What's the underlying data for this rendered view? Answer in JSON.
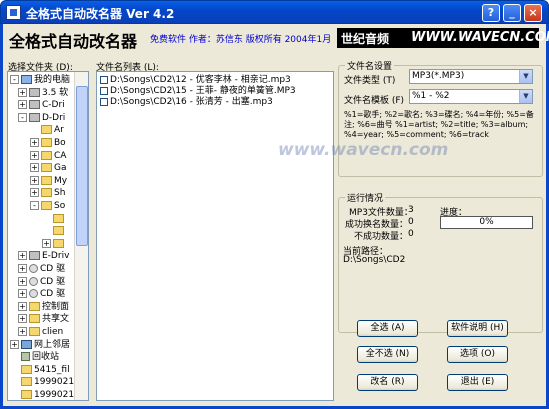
{
  "window": {
    "title": "全格式自动改名器 Ver 4.2",
    "controls": {
      "help": "?",
      "minimize": "_",
      "close": "×"
    }
  },
  "banner": {
    "app_name": "全格式自动改名器",
    "credits": "免费软件  作者：苏信东  版权所有  2004年1月",
    "logo_cn": "世纪音频",
    "logo_url": "WWW.WAVECN.COM"
  },
  "folder_panel": {
    "label": "选择文件夹 (D):",
    "tree": [
      {
        "text": "我的电脑",
        "icon": "pc-icon",
        "exp": "-"
      },
      {
        "text": "3.5 软",
        "icon": "drive-icon",
        "exp": "+"
      },
      {
        "text": "C-Dri",
        "icon": "drive-icon",
        "exp": "+"
      },
      {
        "text": "D-Dri",
        "icon": "drive-icon",
        "exp": "-"
      },
      {
        "text": "Ar",
        "icon": "folder-icon",
        "exp": ""
      },
      {
        "text": "Bo",
        "icon": "folder-icon",
        "exp": "+"
      },
      {
        "text": "CA",
        "icon": "folder-icon",
        "exp": "+"
      },
      {
        "text": "Ga",
        "icon": "folder-icon",
        "exp": "+"
      },
      {
        "text": "My",
        "icon": "folder-icon",
        "exp": "+"
      },
      {
        "text": "Sh",
        "icon": "folder-icon",
        "exp": "+"
      },
      {
        "text": "So",
        "icon": "folder-icon",
        "exp": "-"
      },
      {
        "text": "",
        "icon": "folder-icon",
        "exp": ""
      },
      {
        "text": "",
        "icon": "folder-icon",
        "exp": ""
      },
      {
        "text": "",
        "icon": "folder-icon",
        "exp": "+"
      },
      {
        "text": "E-Driv",
        "icon": "drive-icon",
        "exp": "+"
      },
      {
        "text": "CD 驱",
        "icon": "cd-icon",
        "exp": "+"
      },
      {
        "text": "CD 驱",
        "icon": "cd-icon",
        "exp": "+"
      },
      {
        "text": "CD 驱",
        "icon": "cd-icon",
        "exp": "+"
      },
      {
        "text": "控制面",
        "icon": "folder-icon",
        "exp": "+"
      },
      {
        "text": "共享文",
        "icon": "folder-icon",
        "exp": "+"
      },
      {
        "text": "clien",
        "icon": "folder-icon",
        "exp": "+"
      },
      {
        "text": "网上邻居",
        "icon": "network-icon",
        "exp": "+"
      },
      {
        "text": "回收站",
        "icon": "trash-icon",
        "exp": ""
      },
      {
        "text": "5415_fil",
        "icon": "folder-icon",
        "exp": ""
      },
      {
        "text": "19990219",
        "icon": "folder-icon",
        "exp": ""
      },
      {
        "text": "19990219",
        "icon": "folder-icon",
        "exp": ""
      }
    ]
  },
  "file_panel": {
    "label": "文件名列表 (L):",
    "files": [
      "D:\\Songs\\CD2\\12 - 优客李林 - 相亲记.mp3",
      "D:\\Songs\\CD2\\15 - 王菲- 静夜的单簧管.MP3",
      "D:\\Songs\\CD2\\16 - 张清芳 - 出塞.mp3"
    ]
  },
  "settings": {
    "group_title": "文件名设置",
    "type_label": "文件类型 (T)",
    "type_value": "MP3(*.MP3)",
    "template_label": "文件名模板 (F)",
    "template_value": "%1 - %2",
    "help_text": "%1=歌手; %2=歌名; %3=碟名; %4=年份; %5=备注; %6=曲号 %1=artist; %2=title; %3=album; %4=year; %5=comment; %6=track"
  },
  "status": {
    "group_title": "运行情况",
    "mp3_count_label": "MP3文件数量：",
    "mp3_count": "3",
    "success_label": "成功换名数量：",
    "success_count": "0",
    "fail_label": "不成功数量：",
    "fail_count": "0",
    "progress_label": "进度：",
    "progress_text": "0%",
    "progress_value": 0,
    "path_label": "当前路径：",
    "path_value": "D:\\Songs\\CD2"
  },
  "buttons": {
    "select_all": "全选 (A)",
    "help": "软件说明 (H)",
    "deselect_all": "全不选 (N)",
    "options": "选项 (O)",
    "rename": "改名 (R)",
    "exit": "退出 (E)"
  },
  "watermark": "www.wavecn.com"
}
